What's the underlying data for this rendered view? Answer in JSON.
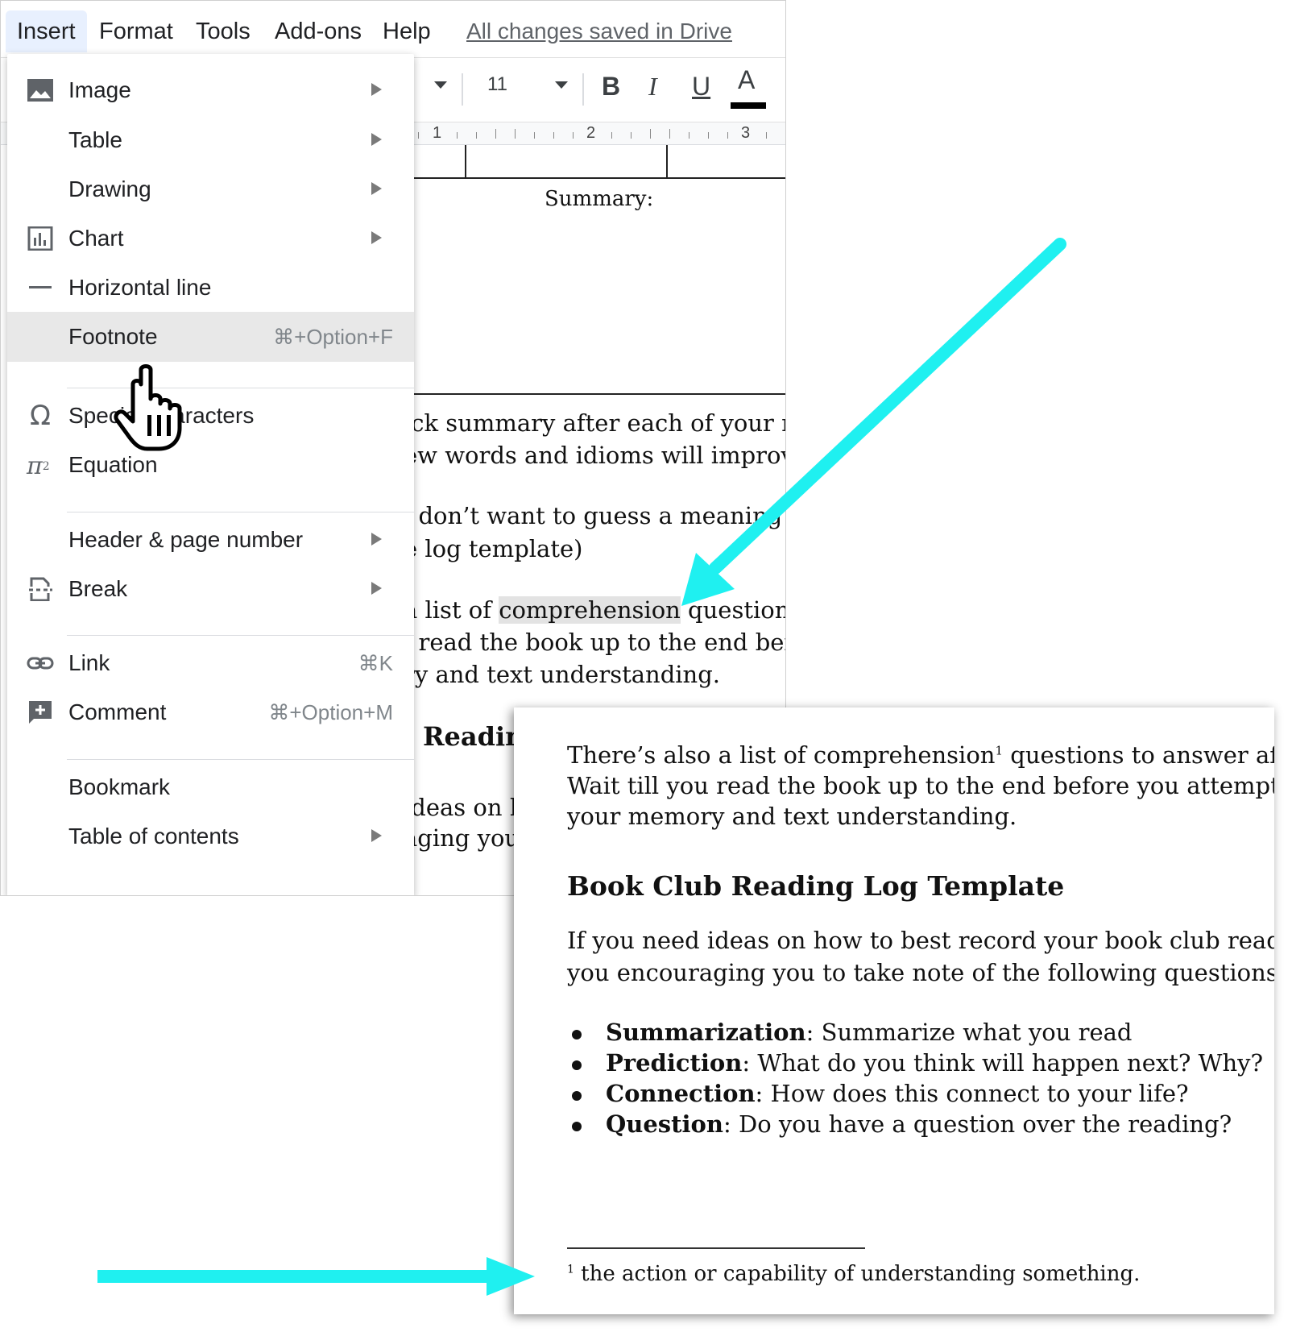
{
  "menubar": {
    "items": [
      "Insert",
      "Format",
      "Tools",
      "Add-ons",
      "Help"
    ],
    "saved_status": "All changes saved in Drive"
  },
  "toolbar": {
    "font_size": "11",
    "bold": "B",
    "italic": "I",
    "underline": "U",
    "text_color": "A"
  },
  "ruler": {
    "numbers": [
      "1",
      "2",
      "3"
    ]
  },
  "insert_menu": {
    "items": [
      {
        "label": "Image",
        "icon": "image-icon",
        "submenu": true
      },
      {
        "label": "Table",
        "submenu": true
      },
      {
        "label": "Drawing",
        "submenu": true
      },
      {
        "label": "Chart",
        "icon": "chart-icon",
        "submenu": true
      },
      {
        "label": "Horizontal line",
        "icon": "horizontal-line-icon"
      },
      {
        "label": "Footnote",
        "shortcut": "⌘+Option+F",
        "highlighted": true
      },
      {
        "label": "Special characters",
        "icon": "omega-icon"
      },
      {
        "label": "Equation",
        "icon": "pi-icon"
      },
      {
        "label": "Header & page number",
        "submenu": true
      },
      {
        "label": "Break",
        "icon": "page-break-icon",
        "submenu": true
      },
      {
        "label": "Link",
        "icon": "link-icon",
        "shortcut": "⌘K"
      },
      {
        "label": "Comment",
        "icon": "add-comment-icon",
        "shortcut": "⌘+Option+M"
      },
      {
        "label": "Bookmark"
      },
      {
        "label": "Table of contents",
        "submenu": true
      }
    ]
  },
  "doc_background": {
    "summary_label": "Summary:",
    "lines": [
      "ick summary after each of your re",
      "ew words and idioms will improve",
      "ı don’t want to guess a meaning",
      "e log template)",
      "a list of ",
      "comprehension",
      " questions",
      "ı read the book up to the end befo",
      "ry and text understanding.",
      "› Readin",
      "ideas on h",
      "aging you"
    ]
  },
  "zoom_panel": {
    "para1": {
      "line1_a": "There’s also a list of comprehension",
      "line1_sup": "1",
      "line1_b": " questions to answer after yo",
      "line2": "Wait till you read the book up to the end before you attempt to a",
      "line3": "your memory and text understanding."
    },
    "heading": "Book Club Reading Log Template",
    "para2": {
      "line1": "If you need ideas on how to best record your book club reading, ",
      "line2": "you encouraging you to take note of the following questions:"
    },
    "bullets": [
      {
        "term": "Summarization",
        "text": ": Summarize what you read"
      },
      {
        "term": "Prediction",
        "text": ": What do you think will happen next? Why?"
      },
      {
        "term": "Connection",
        "text": ": How does this connect to your life?"
      },
      {
        "term": "Question",
        "text": ": Do you have a question over the reading?"
      }
    ],
    "footnote": {
      "number": "1",
      "text": " the action or capability of understanding something."
    }
  },
  "colors": {
    "annotation_arrow": "#1ff0f0",
    "menu_hover": "#e8e8e8",
    "active_menu": "#e8f0fe"
  }
}
